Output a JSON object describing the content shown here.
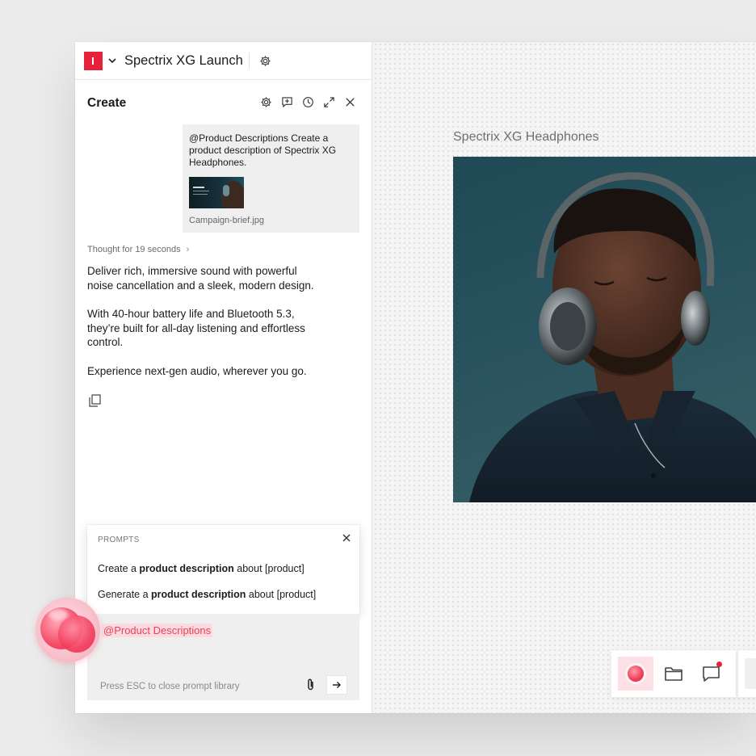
{
  "project": {
    "title": "Spectrix XG Launch"
  },
  "panel": {
    "title": "Create",
    "user_message": {
      "text": "@Product Descriptions Create a product description of Spectrix XG Headphones.",
      "attachment_name": "Campaign-brief.jpg"
    },
    "thought_label": "Thought for 19 seconds",
    "thought_chevron": "›",
    "response": [
      "Deliver rich, immersive sound with powerful noise cancellation and a sleek, modern design.",
      "With 40-hour battery life and Bluetooth 5.3, they’re built for all-day listening and effortless control.",
      "Experience next-gen audio, wherever you go."
    ]
  },
  "prompts": {
    "header": "PROMPTS",
    "items": [
      {
        "parts": [
          "Create a ",
          "product description",
          " about [product]"
        ]
      },
      {
        "parts": [
          "Generate a ",
          "product description",
          " about [product]"
        ]
      }
    ]
  },
  "input": {
    "mention": "@Product Descriptions",
    "hint": "Press ESC to close prompt library"
  },
  "canvas": {
    "artboard_title": "Spectrix XG Headphones"
  },
  "icons": {
    "logo": "brand-logo-icon",
    "settings": "gear-icon",
    "new_chat": "chat-plus-icon",
    "history": "clock-icon",
    "expand": "expand-icon",
    "close": "close-icon",
    "copy": "copy-icon",
    "attach": "paperclip-icon",
    "send": "arrow-right-icon",
    "folder": "folder-icon",
    "comments": "comment-icon"
  },
  "colors": {
    "brand": "#e8213b",
    "mention_bg": "#fcdbe0",
    "mention_text": "#e8415a"
  }
}
